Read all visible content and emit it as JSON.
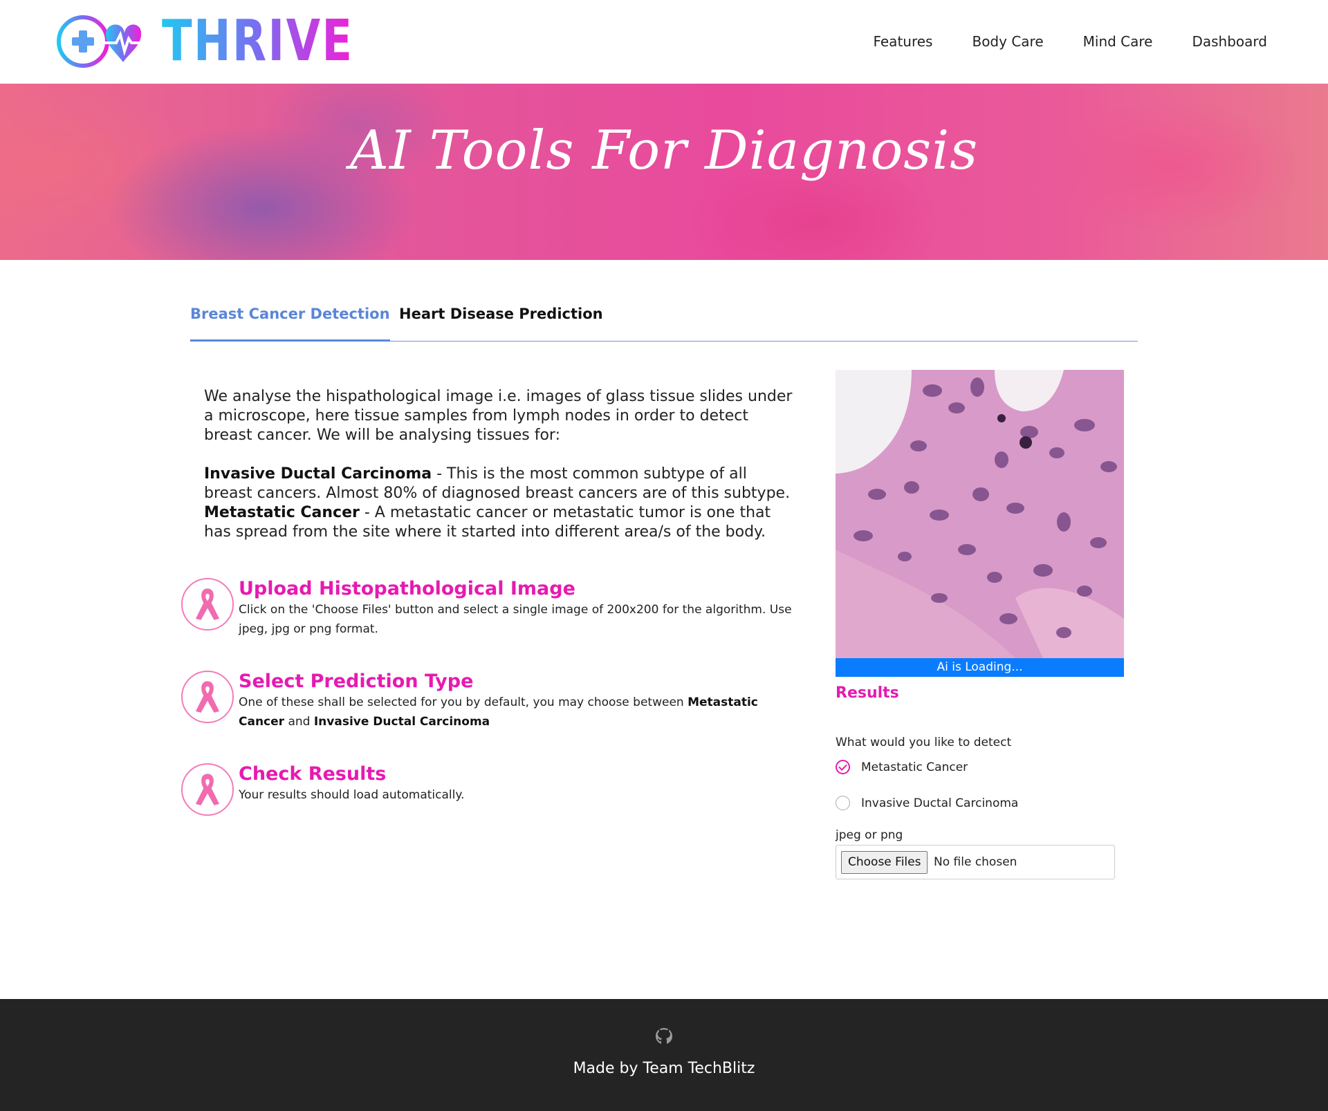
{
  "brand": {
    "name": "THRIVE",
    "logo_icon": "heart-medical-plus-logo-icon"
  },
  "nav": {
    "items": [
      {
        "label": "Features"
      },
      {
        "label": "Body Care"
      },
      {
        "label": "Mind Care"
      },
      {
        "label": "Dashboard"
      }
    ]
  },
  "banner": {
    "title": "AI Tools For Diagnosis"
  },
  "tabs": [
    {
      "label": "Breast Cancer Detection",
      "active": true
    },
    {
      "label": "Heart Disease Prediction",
      "active": false
    }
  ],
  "description": {
    "intro": "We analyse the hispathological image i.e. images of glass tissue slides under a microscope, here tissue samples from lymph nodes in order to detect breast cancer. We will be analysing tissues for:",
    "idc_term": "Invasive Ductal Carcinoma",
    "idc_text": " - This is the most common subtype of all breast cancers. Almost 80% of diagnosed breast cancers are of this subtype.",
    "meta_term": "Metastatic Cancer",
    "meta_text": " - A metastatic cancer or metastatic tumor is one that has spread from the site where it started into different area/s of the body."
  },
  "steps": [
    {
      "title": "Upload Histopathological Image",
      "text": "Click on the 'Choose Files' button and select a single image of 200x200 for the algorithm. Use jpeg, jpg or png format.",
      "icon": "pink-ribbon-icon"
    },
    {
      "title": "Select Prediction Type",
      "text_pre": "One of these shall be selected for you by default, you may choose between ",
      "bold_1": "Metastatic Cancer",
      "text_mid": " and ",
      "bold_2": "Invasive Ductal Carcinoma",
      "icon": "pink-ribbon-icon"
    },
    {
      "title": "Check Results",
      "text": "Your results should load automatically.",
      "icon": "pink-ribbon-icon"
    }
  ],
  "predictor": {
    "loading_text": "Ai is Loading...",
    "results_label": "Results",
    "detect_label": "What would you like to detect",
    "options": [
      {
        "label": "Metastatic Cancer",
        "selected": true
      },
      {
        "label": "Invasive Ductal Carcinoma",
        "selected": false
      }
    ],
    "file_hint": "jpeg or png",
    "choose_button": "Choose Files",
    "file_status": "No file chosen"
  },
  "footer": {
    "icon": "github-icon",
    "text": "Made by Team TechBlitz"
  },
  "colors": {
    "accent_pink": "#e61ab0",
    "tab_blue": "#5a86d8",
    "loading_blue": "#0a7cff",
    "footer_bg": "#242424"
  }
}
